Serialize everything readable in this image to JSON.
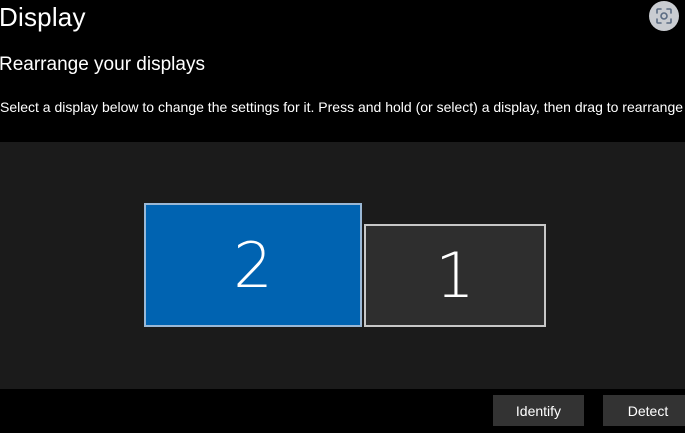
{
  "header": {
    "title": "Display",
    "focus_icon": "focus-scan-icon"
  },
  "arrange": {
    "heading": "Rearrange your displays",
    "description": "Select a display below to change the settings for it. Press and hold (or select) a display, then drag to rearrange i",
    "displays": [
      {
        "number": "2",
        "selected": true,
        "color": "#0063b1"
      },
      {
        "number": "1",
        "selected": false,
        "color": "#2e2e2e"
      }
    ],
    "identify_label": "Identify",
    "detect_label": "Detect"
  },
  "colors": {
    "background": "#000000",
    "canvas": "#1b1b1b",
    "accent": "#0063b1",
    "button": "#333333"
  }
}
